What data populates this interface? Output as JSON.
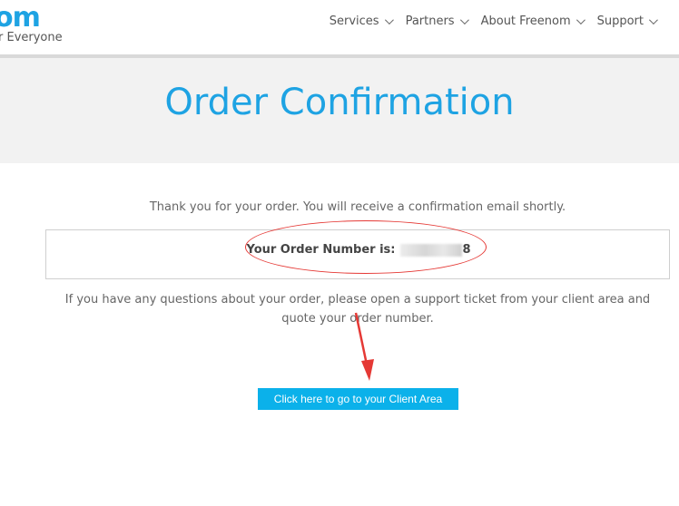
{
  "header": {
    "logo_text": "om",
    "tagline": "r Everyone",
    "nav": [
      {
        "label": "Services"
      },
      {
        "label": "Partners"
      },
      {
        "label": "About Freenom"
      },
      {
        "label": "Support"
      }
    ]
  },
  "banner": {
    "title": "Order Confirmation"
  },
  "main": {
    "thanks_text": "Thank you for your order. You will receive a confirmation email shortly.",
    "order_label": "Your Order Number is:",
    "order_number_suffix": "8",
    "note_text": "If you have any questions about your order, please open a support ticket from your client area and quote your order number.",
    "client_button_label": "Click here to go to your Client Area"
  },
  "colors": {
    "accent": "#1ea3e3",
    "button": "#0bb1ea",
    "annotation": "#e53935"
  }
}
